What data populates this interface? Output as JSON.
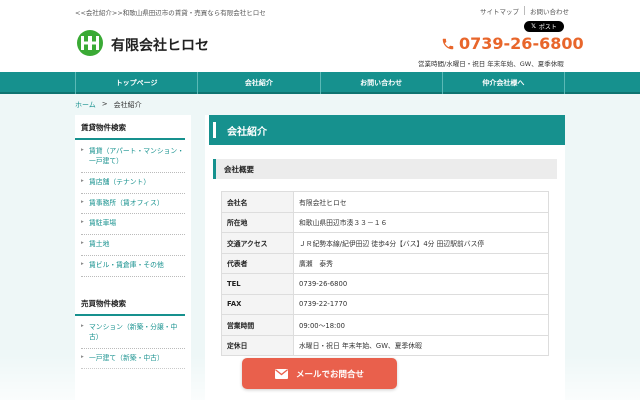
{
  "header": {
    "tagline": "<<会社紹介>>和歌山県田辺市の賃貸・売買なら有限会社ヒロセ",
    "toplinks": [
      "サイトマップ",
      "お問い合わせ"
    ],
    "xpost_label": "ポスト",
    "company_name": "有限会社ヒロセ",
    "phone": "0739-26-6800",
    "hours": "営業時間/水曜日・祝日 年末年始、GW、夏季休暇"
  },
  "nav": [
    "トップページ",
    "会社紹介",
    "お問い合わせ",
    "仲介会社様へ"
  ],
  "breadcrumb": {
    "home": "ホーム",
    "sep": ">",
    "current": "会社紹介"
  },
  "sidebar": {
    "rent_heading": "賃貸物件検索",
    "rent_items": [
      "賃貸（アパート・マンション・一戸建て）",
      "賃店舗（テナント）",
      "賃事務所（賃オフィス）",
      "賃駐車場",
      "賃土地",
      "賃ビル・賃倉庫・その他"
    ],
    "sale_heading": "売買物件検索",
    "sale_items": [
      "マンション（新築・分譲・中古）",
      "一戸建て（新築・中古）"
    ]
  },
  "main": {
    "title": "会社紹介",
    "section": "会社概要",
    "rows": [
      {
        "label": "会社名",
        "value": "有限会社ヒロセ"
      },
      {
        "label": "所在地",
        "value": "和歌山県田辺市湊３３－１６"
      },
      {
        "label": "交通アクセス",
        "value": "ＪＲ紀勢本線/紀伊田辺 徒歩4分【バス】4分 田辺駅前バス停"
      },
      {
        "label": "代表者",
        "value": "廣瀬　泰秀"
      },
      {
        "label": "TEL",
        "value": "0739-26-6800"
      },
      {
        "label": "FAX",
        "value": "0739-22-1770"
      },
      {
        "label": "営業時間",
        "value": "09:00～18:00"
      },
      {
        "label": "定休日",
        "value": "水曜日・祝日 年末年始、GW、夏季休暇"
      }
    ]
  },
  "mail_button": "メールでお問合せ",
  "colors": {
    "accent": "#16918e",
    "phone": "#e8662b",
    "button": "#e9604c",
    "logo": "#3aaa35"
  }
}
